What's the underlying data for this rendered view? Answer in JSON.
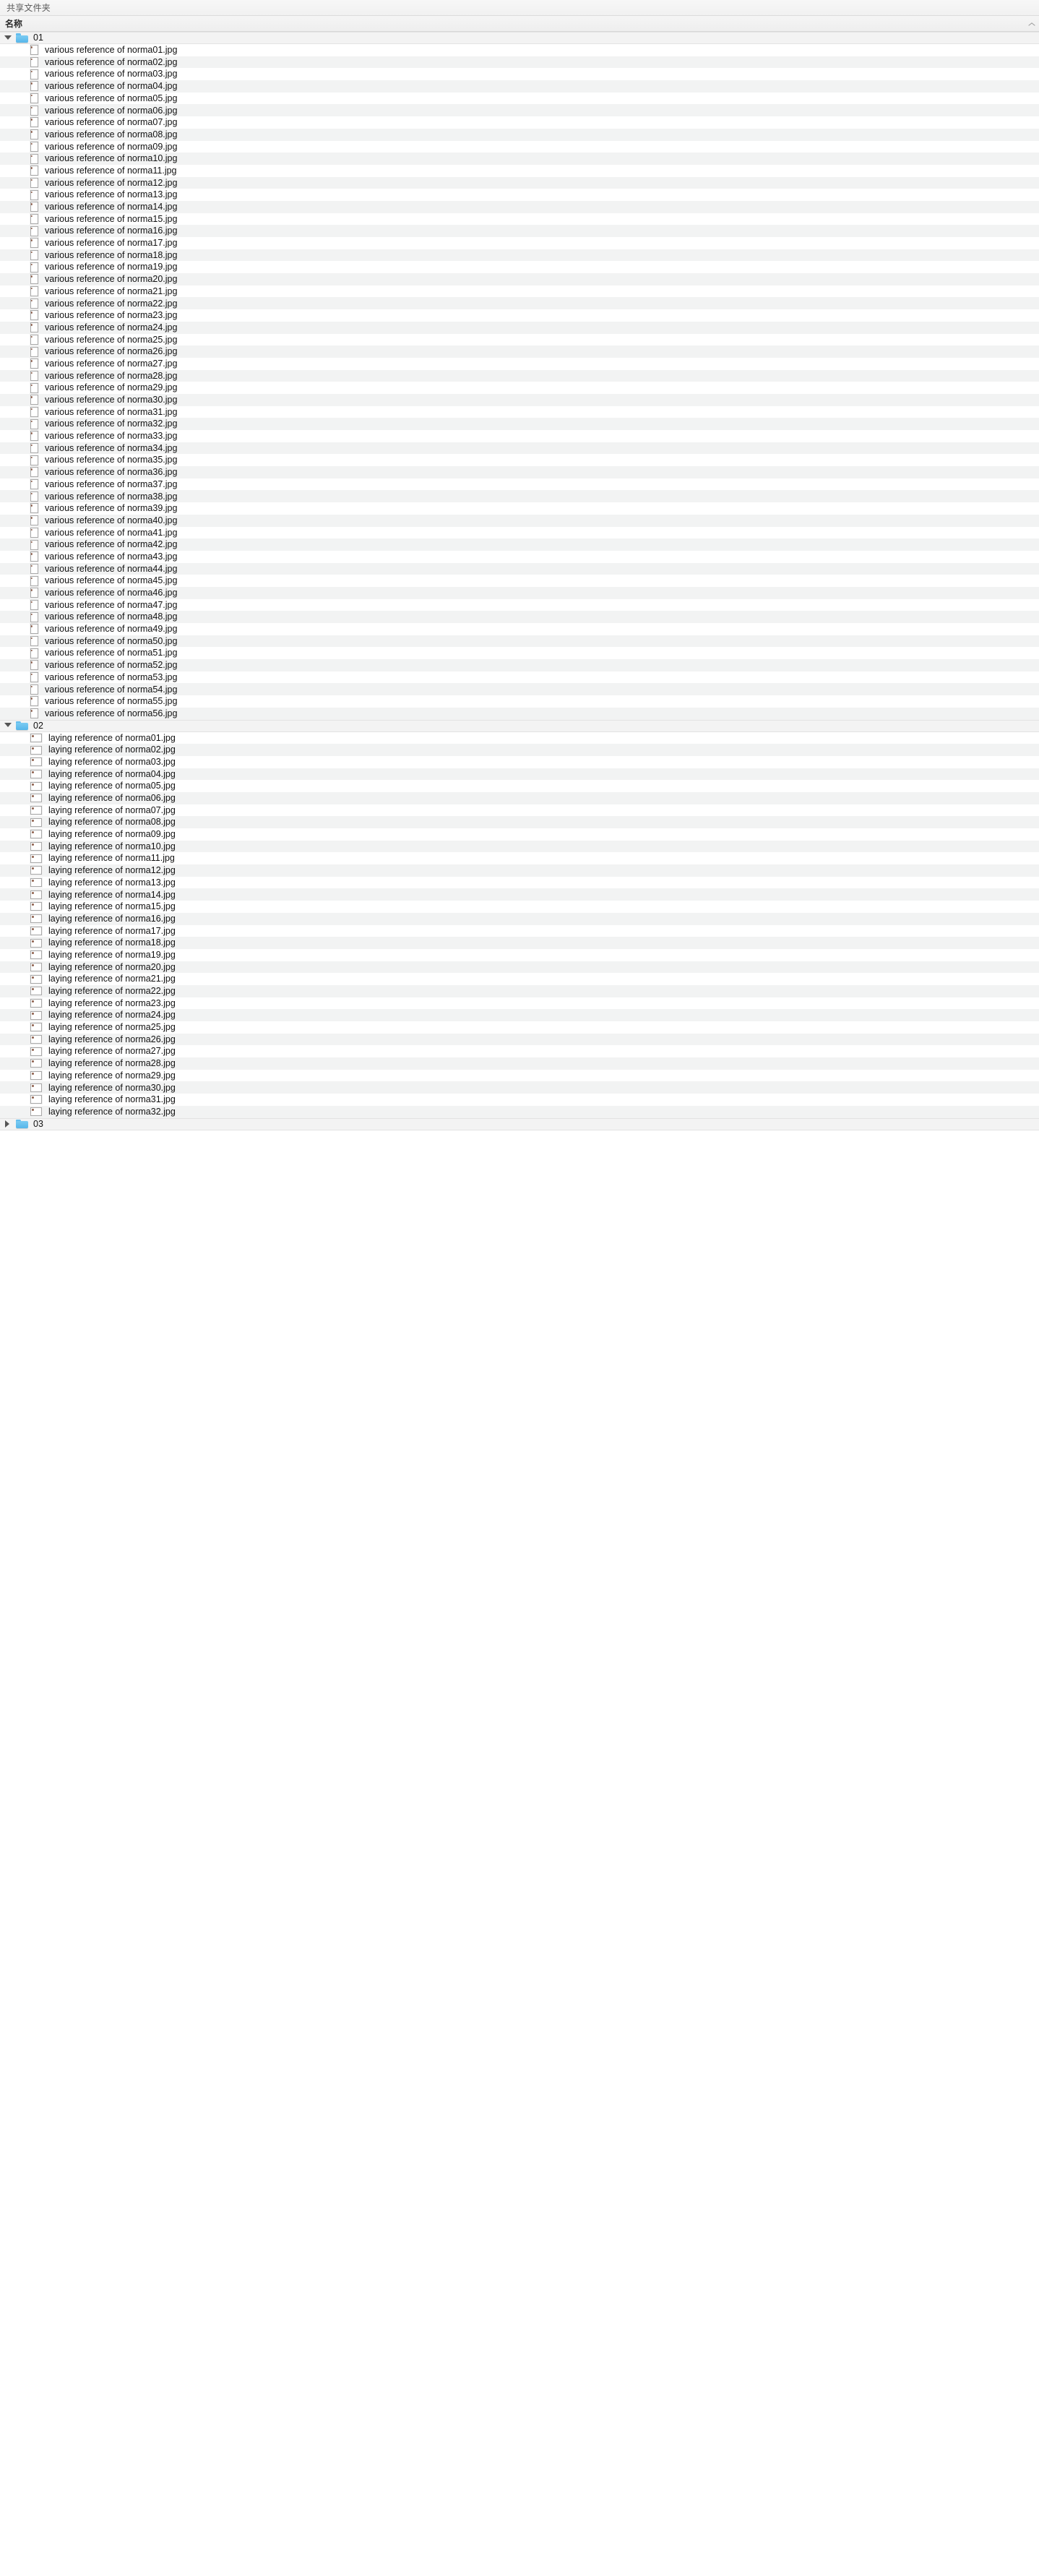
{
  "window": {
    "title": "共享文件夹"
  },
  "column_header": {
    "name_label": "名称",
    "sort_icon": "chevron-up-icon"
  },
  "icons": {
    "folder": "folder-icon",
    "expanded": "triangle-down-icon",
    "collapsed": "triangle-right-icon",
    "file_thumb": "image-thumbnail-icon"
  },
  "tree": [
    {
      "name": "01",
      "expanded": true,
      "thumb_shape": "portrait",
      "files": [
        "various reference of norma01.jpg",
        "various reference of norma02.jpg",
        "various reference of norma03.jpg",
        "various reference of norma04.jpg",
        "various reference of norma05.jpg",
        "various reference of norma06.jpg",
        "various reference of norma07.jpg",
        "various reference of norma08.jpg",
        "various reference of norma09.jpg",
        "various reference of norma10.jpg",
        "various reference of norma11.jpg",
        "various reference of norma12.jpg",
        "various reference of norma13.jpg",
        "various reference of norma14.jpg",
        "various reference of norma15.jpg",
        "various reference of norma16.jpg",
        "various reference of norma17.jpg",
        "various reference of norma18.jpg",
        "various reference of norma19.jpg",
        "various reference of norma20.jpg",
        "various reference of norma21.jpg",
        "various reference of norma22.jpg",
        "various reference of norma23.jpg",
        "various reference of norma24.jpg",
        "various reference of norma25.jpg",
        "various reference of norma26.jpg",
        "various reference of norma27.jpg",
        "various reference of norma28.jpg",
        "various reference of norma29.jpg",
        "various reference of norma30.jpg",
        "various reference of norma31.jpg",
        "various reference of norma32.jpg",
        "various reference of norma33.jpg",
        "various reference of norma34.jpg",
        "various reference of norma35.jpg",
        "various reference of norma36.jpg",
        "various reference of norma37.jpg",
        "various reference of norma38.jpg",
        "various reference of norma39.jpg",
        "various reference of norma40.jpg",
        "various reference of norma41.jpg",
        "various reference of norma42.jpg",
        "various reference of norma43.jpg",
        "various reference of norma44.jpg",
        "various reference of norma45.jpg",
        "various reference of norma46.jpg",
        "various reference of norma47.jpg",
        "various reference of norma48.jpg",
        "various reference of norma49.jpg",
        "various reference of norma50.jpg",
        "various reference of norma51.jpg",
        "various reference of norma52.jpg",
        "various reference of norma53.jpg",
        "various reference of norma54.jpg",
        "various reference of norma55.jpg",
        "various reference of norma56.jpg"
      ]
    },
    {
      "name": "02",
      "expanded": true,
      "thumb_shape": "landscape",
      "files": [
        "laying reference of norma01.jpg",
        "laying reference of norma02.jpg",
        "laying reference of norma03.jpg",
        "laying reference of norma04.jpg",
        "laying reference of norma05.jpg",
        "laying reference of norma06.jpg",
        "laying reference of norma07.jpg",
        "laying reference of norma08.jpg",
        "laying reference of norma09.jpg",
        "laying reference of norma10.jpg",
        "laying reference of norma11.jpg",
        "laying reference of norma12.jpg",
        "laying reference of norma13.jpg",
        "laying reference of norma14.jpg",
        "laying reference of norma15.jpg",
        "laying reference of norma16.jpg",
        "laying reference of norma17.jpg",
        "laying reference of norma18.jpg",
        "laying reference of norma19.jpg",
        "laying reference of norma20.jpg",
        "laying reference of norma21.jpg",
        "laying reference of norma22.jpg",
        "laying reference of norma23.jpg",
        "laying reference of norma24.jpg",
        "laying reference of norma25.jpg",
        "laying reference of norma26.jpg",
        "laying reference of norma27.jpg",
        "laying reference of norma28.jpg",
        "laying reference of norma29.jpg",
        "laying reference of norma30.jpg",
        "laying reference of norma31.jpg",
        "laying reference of norma32.jpg"
      ]
    },
    {
      "name": "03",
      "expanded": false,
      "thumb_shape": "portrait",
      "files": []
    }
  ],
  "colors": {
    "folder_blue": "#56b6ea",
    "row_alt": "#f2f3f3",
    "row_base": "#ffffff",
    "header_bg": "#f1f1f1",
    "text": "#111111"
  }
}
